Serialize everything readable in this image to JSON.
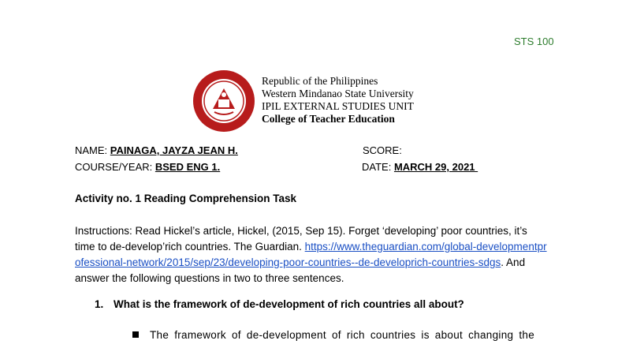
{
  "course_code": "STS 100",
  "header": {
    "republic": "Republic of the Philippines",
    "university": "Western Mindanao State University",
    "unit": "IPIL EXTERNAL STUDIES UNIT",
    "college": "College of Teacher Education",
    "seal_text_top": "WESTERN MINDANAO STATE UNIVERSITY",
    "seal_text_bottom": "ZAMBOANGA CITY"
  },
  "form": {
    "name_label": "NAME: ",
    "name_value": "PAINAGA, JAYZA JEAN H.",
    "score_label": "SCORE:",
    "course_label": "COURSE/YEAR: ",
    "course_value": "BSED ENG 1.",
    "date_label": "DATE: ",
    "date_value": "MARCH 29, 2021 "
  },
  "activity_title": "Activity no. 1 Reading Comprehension Task",
  "instructions": {
    "before_link": "Instructions: Read Hickel’s article, Hickel, (2015, Sep 15). Forget ‘developing’ poor countries, it’s time to de-develop’rich countries. The Guardian. ",
    "link": "https://www.theguardian.com/global-developmentprofessional-network/2015/sep/23/developing-poor-countries--de-developrich-countries-sdgs",
    "after_link": ". And answer the following questions in two to three sentences."
  },
  "question": {
    "number": "1.",
    "text": "What is the framework of de-development of rich countries all about?"
  },
  "answer": "The framework of de-development of rich countries is about changing the"
}
